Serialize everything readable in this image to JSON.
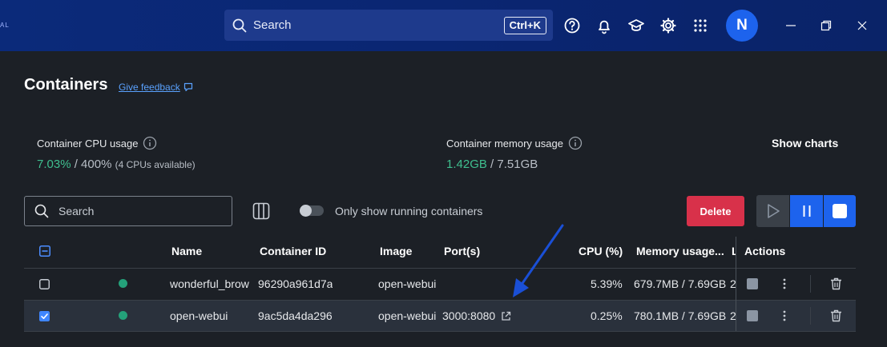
{
  "header": {
    "brand": "AL",
    "search_label": "Search",
    "search_shortcut": "Ctrl+K",
    "avatar_initial": "N"
  },
  "page": {
    "title": "Containers",
    "feedback_link": "Give feedback"
  },
  "stats": {
    "cpu_label": "Container CPU usage",
    "cpu_value": "7.03%",
    "cpu_total": "/ 400%",
    "cpu_note": "(4 CPUs available)",
    "mem_label": "Container memory usage",
    "mem_value": "1.42GB",
    "mem_total": "/ 7.51GB",
    "show_charts": "Show charts"
  },
  "toolbar": {
    "search_placeholder": "Search",
    "only_running_label": "Only show running containers",
    "delete_label": "Delete"
  },
  "table": {
    "columns": [
      "Name",
      "Container ID",
      "Image",
      "Port(s)",
      "CPU (%)",
      "Memory usage...",
      "L",
      "Actions"
    ],
    "rows": [
      {
        "name": "wonderful_brow",
        "id": "96290a961d7a",
        "image": "open-webui",
        "port": "",
        "cpu": "5.39%",
        "memory": "679.7MB / 7.69GB",
        "extra": "2",
        "checked": false
      },
      {
        "name": "open-webui",
        "id": "9ac5da4da296",
        "image": "open-webui",
        "port": "3000:8080",
        "cpu": "0.25%",
        "memory": "780.1MB / 7.69GB",
        "extra": "2",
        "checked": true
      }
    ]
  },
  "colors": {
    "accent": "#1d63ed",
    "danger": "#d8314a",
    "running": "#24a17a",
    "annotation_arrow": "#1a4fd6"
  }
}
